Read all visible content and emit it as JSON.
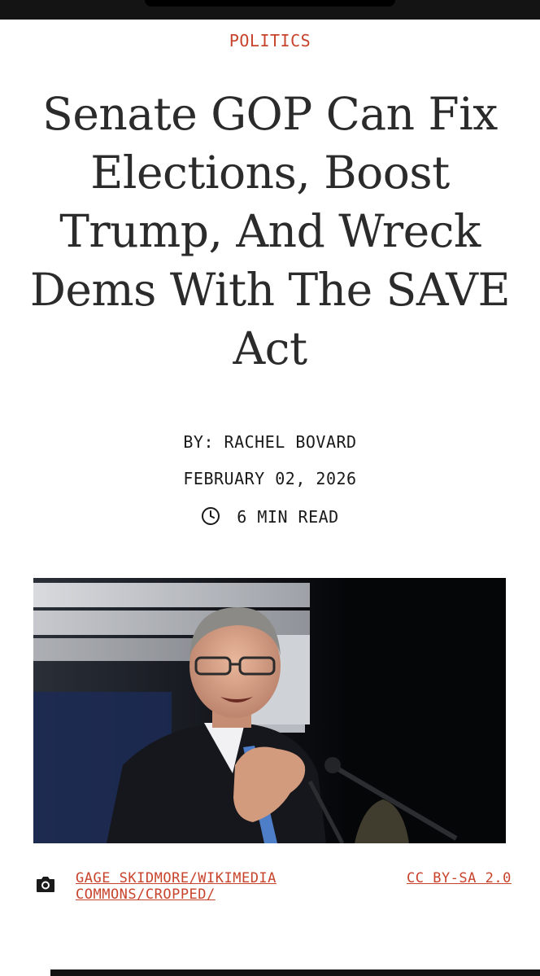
{
  "article": {
    "category": "POLITICS",
    "headline": "Senate GOP Can Fix Elections, Boost Trump, And Wreck Dems With The SAVE Act",
    "byline": "BY: RACHEL BOVARD",
    "date": "FEBRUARY 02, 2026",
    "read_time": "6 MIN READ"
  },
  "image_credit": {
    "source": "GAGE SKIDMORE/WIKIMEDIA COMMONS/CROPPED/",
    "license": "CC BY-SA 2.0"
  },
  "colors": {
    "accent": "#c8432b",
    "headline": "#2b2b2b",
    "text": "#1a1a1a"
  },
  "icons": [
    "clock-icon",
    "camera-icon"
  ]
}
